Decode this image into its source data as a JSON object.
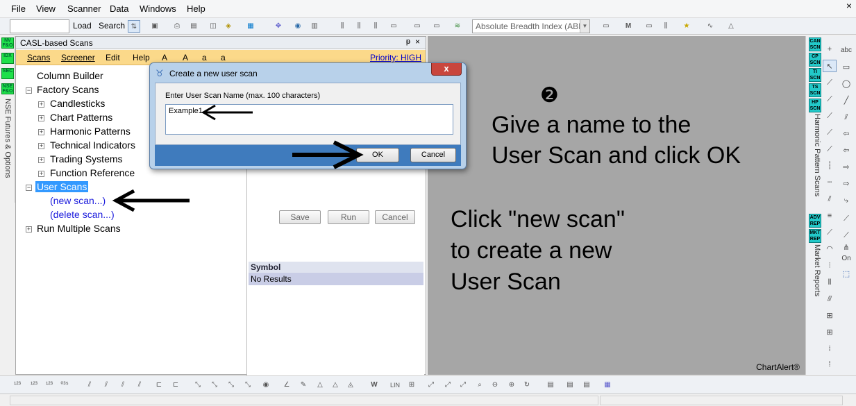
{
  "menubar": {
    "file": "File",
    "view": "View",
    "scanner": "Scanner",
    "data": "Data",
    "windows": "Windows",
    "help": "Help"
  },
  "toolbar": {
    "load": "Load",
    "search": "Search",
    "indicator_combo": "Absolute Breadth Index (ABI"
  },
  "left_strip": {
    "tags": [
      "NV F&O",
      "IDX",
      "SEC",
      "NSE F&O"
    ],
    "vertical_label": "NSE Futures & Options"
  },
  "panel": {
    "title": "CASL-based Scans",
    "menu": {
      "scans": "Scans",
      "screener": "Screener",
      "edit": "Edit",
      "help": "Help",
      "a1": "A",
      "a2": "A",
      "a3": "a",
      "a4": "a",
      "priority": "Priority: HIGH"
    },
    "tree": {
      "column_builder": "Column Builder",
      "factory_scans": "Factory Scans",
      "candlesticks": "Candlesticks",
      "chart_patterns": "Chart Patterns",
      "harmonic_patterns": "Harmonic Patterns",
      "technical_indicators": "Technical Indicators",
      "trading_systems": "Trading Systems",
      "function_reference": "Function Reference",
      "user_scans": "User Scans",
      "new_scan": "(new scan...)",
      "delete_scan": "(delete scan...)",
      "run_multiple": "Run Multiple Scans"
    },
    "buttons": {
      "save": "Save",
      "run": "Run",
      "cancel": "Cancel"
    },
    "results": {
      "header": "Symbol",
      "row": "No Results"
    }
  },
  "chart": {
    "step_marker": "❷",
    "instruction_1_line1": "Give a name to the",
    "instruction_1_line2": "User Scan and click OK",
    "instruction_2_line1": "Click \"new scan\"",
    "instruction_2_line2": "to create a new",
    "instruction_2_line3": "User Scan",
    "brand": "ChartAlert®"
  },
  "right_strip": {
    "tags": [
      "CAN SCN",
      "CP SCN",
      "TI SCN",
      "TS SCN",
      "HP SCN"
    ],
    "tags2": [
      "ADV REP",
      "MKT REP"
    ],
    "vertical_label_1": "Harmonic Pattern Scans",
    "vertical_label_2": "Market Reports",
    "abc": "abc",
    "on": "On"
  },
  "bottombar": {
    "w_label": "W",
    "lin_label": "LIN"
  },
  "dialog": {
    "title": "Create a new user scan",
    "close": "x",
    "label": "Enter User Scan Name (max. 100 characters)",
    "value": "Example1",
    "ok": "OK",
    "cancel": "Cancel"
  },
  "colors": {
    "chart_bg": "#a6a6a6",
    "menu_orange": "#fbd98a",
    "selection": "#3399ff",
    "dialog_footer": "#3f7bbd",
    "close_red": "#c9463d"
  }
}
